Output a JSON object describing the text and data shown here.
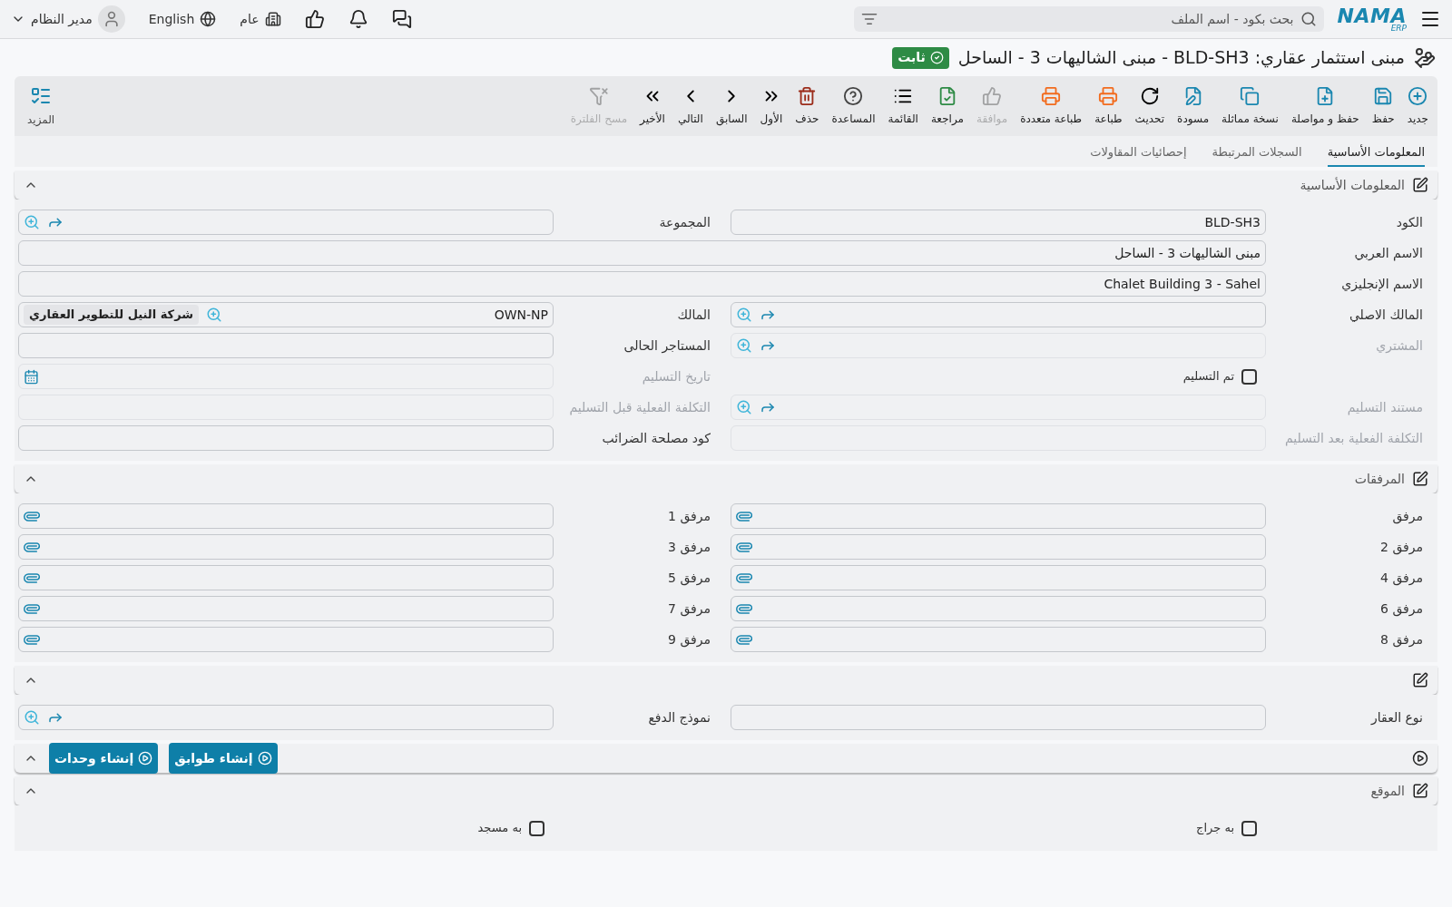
{
  "topbar": {
    "logo": "NAMA",
    "logo_sub": "ERP",
    "search": {
      "placeholder": "بحث بكود - اسم الملف"
    },
    "branch": "عام",
    "language": "English",
    "user": "مدير النظام"
  },
  "title": {
    "text": "مبنى استثمار عقاري: BLD-SH3 - مبنى الشاليهات 3 - الساحل",
    "status": "ثابت"
  },
  "toolbar": [
    {
      "kind": "new",
      "label": "جديد",
      "disabled": false
    },
    {
      "kind": "save",
      "label": "حفظ",
      "disabled": false
    },
    {
      "kind": "savenext",
      "label": "حفظ و مواصلة",
      "disabled": false
    },
    {
      "kind": "copy",
      "label": "نسخة مماثلة",
      "disabled": false
    },
    {
      "kind": "draft",
      "label": "مسودة",
      "disabled": false
    },
    {
      "kind": "refresh",
      "label": "تحديث",
      "disabled": false
    },
    {
      "kind": "print",
      "label": "طباعة",
      "disabled": false
    },
    {
      "kind": "multiprint",
      "label": "طباعة متعددة",
      "disabled": false
    },
    {
      "kind": "approve",
      "label": "موافقة",
      "disabled": true
    },
    {
      "kind": "review",
      "label": "مراجعة",
      "disabled": false
    },
    {
      "kind": "list",
      "label": "القائمة",
      "disabled": false
    },
    {
      "kind": "help",
      "label": "المساعدة",
      "disabled": false
    },
    {
      "kind": "delete",
      "label": "حذف",
      "disabled": false
    },
    {
      "kind": "first",
      "label": "الأول",
      "disabled": false
    },
    {
      "kind": "prev",
      "label": "السابق",
      "disabled": false
    },
    {
      "kind": "next",
      "label": "التالي",
      "disabled": false
    },
    {
      "kind": "last",
      "label": "الأخير",
      "disabled": false
    },
    {
      "kind": "clearfilter",
      "label": "مسح الفلترة",
      "disabled": true
    }
  ],
  "more": {
    "label": "المزيد"
  },
  "tabs": [
    {
      "label": "المعلومات الأساسية",
      "selected": true
    },
    {
      "label": "السجلات المرتبطة",
      "selected": false
    },
    {
      "label": "إحصائيات المقاولات",
      "selected": false
    }
  ],
  "sections": [
    {
      "kind": "form",
      "title": "المعلومات الأساسية",
      "expanded": true,
      "rows": [
        [
          {
            "kind": "text",
            "label": "الكود",
            "value": "BLD-SH3",
            "disabled": false
          },
          {
            "kind": "lookup",
            "label": "المجموعة",
            "disabled": false
          }
        ],
        [
          {
            "kind": "text",
            "label": "الاسم العربي",
            "value": "مبنى الشاليهات 3 - الساحل",
            "disabled": false,
            "wide": true
          }
        ],
        [
          {
            "kind": "text",
            "label": "الاسم الإنجليزي",
            "value": "Chalet Building 3 - Sahel",
            "disabled": false,
            "wide": true
          }
        ],
        [
          {
            "kind": "lookup",
            "label": "المالك الاصلي",
            "disabled": false
          },
          {
            "kind": "owner",
            "label": "المالك",
            "value": "OWN-NP",
            "chip": "شركة النيل للتطوير العقاري",
            "disabled": false
          }
        ],
        [
          {
            "kind": "lookup",
            "label": "المشتري",
            "disabled": true
          },
          {
            "kind": "text",
            "label": "المستاجر الحالى",
            "disabled": false
          }
        ],
        [
          {
            "kind": "checkbox",
            "label": "تم التسليم",
            "checked": false
          },
          {
            "kind": "date",
            "label": "تاريخ التسليم",
            "disabled": true
          }
        ],
        [
          {
            "kind": "lookup",
            "label": "مستند التسليم",
            "disabled": true
          },
          {
            "kind": "text",
            "label": "التكلفة الفعلية قبل التسليم",
            "disabled": true
          }
        ],
        [
          {
            "kind": "text",
            "label": "التكلفة الفعلية بعد التسليم",
            "disabled": true
          },
          {
            "kind": "text",
            "label": "كود مصلحة الضرائب",
            "disabled": false
          }
        ]
      ]
    },
    {
      "kind": "form",
      "title": "المرفقات",
      "expanded": true,
      "rows": [
        [
          {
            "kind": "attachment",
            "label": "مرفق",
            "disabled": false
          },
          {
            "kind": "attachment",
            "label": "مرفق 1",
            "disabled": false
          }
        ],
        [
          {
            "kind": "attachment",
            "label": "مرفق 2",
            "disabled": false
          },
          {
            "kind": "attachment",
            "label": "مرفق 3",
            "disabled": false
          }
        ],
        [
          {
            "kind": "attachment",
            "label": "مرفق 4",
            "disabled": false
          },
          {
            "kind": "attachment",
            "label": "مرفق 5",
            "disabled": false
          }
        ],
        [
          {
            "kind": "attachment",
            "label": "مرفق 6",
            "disabled": false
          },
          {
            "kind": "attachment",
            "label": "مرفق 7",
            "disabled": false
          }
        ],
        [
          {
            "kind": "attachment",
            "label": "مرفق 8",
            "disabled": false
          },
          {
            "kind": "attachment",
            "label": "مرفق 9",
            "disabled": false
          }
        ]
      ]
    },
    {
      "kind": "form",
      "expanded": true,
      "rows": [
        [
          {
            "kind": "text",
            "label": "نوع العقار",
            "disabled": false
          },
          {
            "kind": "lookup",
            "label": "نموذج الدفع",
            "disabled": false
          }
        ]
      ]
    },
    {
      "kind": "actions",
      "expanded": true,
      "buttons": [
        "إنشاء طوابق",
        "إنشاء وحدات"
      ]
    },
    {
      "kind": "form",
      "title": "الموقع",
      "expanded": true,
      "rows": [
        [
          {
            "kind": "checkbox",
            "label": "به جراج",
            "checked": false
          },
          {
            "kind": "checkbox",
            "label": "به مسجد",
            "checked": false
          }
        ]
      ]
    }
  ]
}
